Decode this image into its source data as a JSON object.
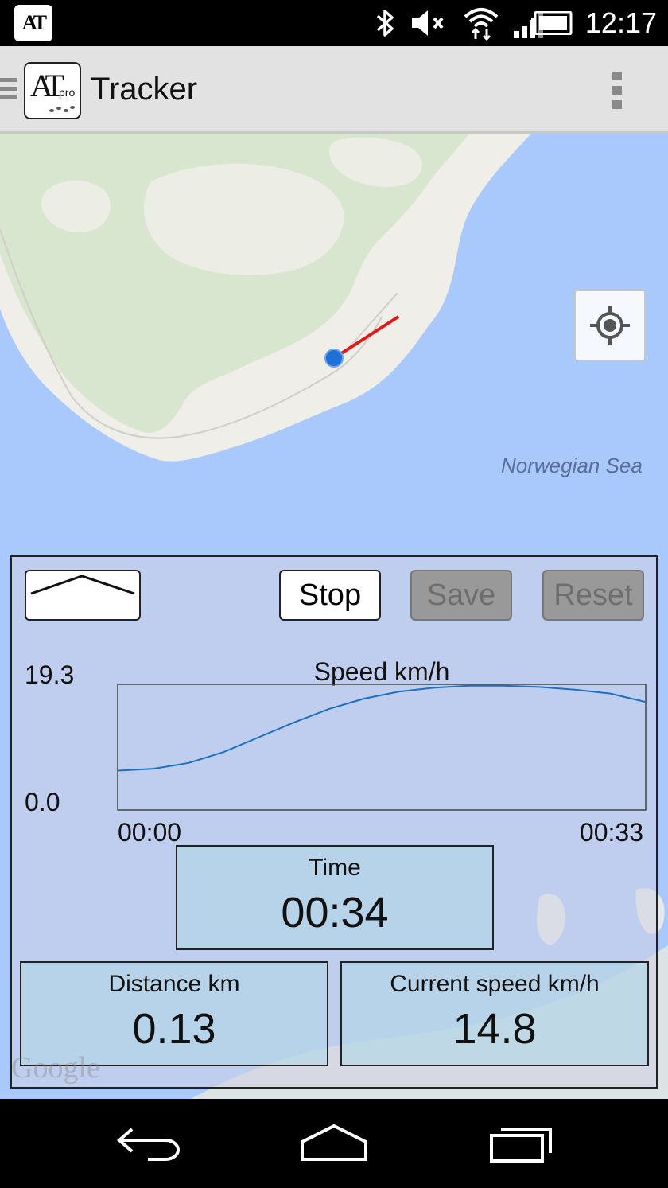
{
  "status_bar": {
    "app_icon_text": "AT",
    "time": "12:17",
    "icons": [
      "bluetooth-icon",
      "volume-muted-icon",
      "wifi-icon",
      "signal-icon",
      "battery-icon"
    ]
  },
  "action_bar": {
    "title": "Tracker",
    "logo_text": "AT",
    "logo_sub": "pro"
  },
  "map": {
    "sea_label": "Norwegian Sea",
    "attribution": "Google",
    "colors": {
      "water": "#a9c9fd",
      "land": "#efeee9",
      "forest": "#d9e6cf",
      "track": "#e01818",
      "position": "#1f6fd6"
    }
  },
  "panel": {
    "buttons": {
      "stop": "Stop",
      "save": "Save",
      "reset": "Reset"
    },
    "time": {
      "label": "Time",
      "value": "00:34"
    },
    "distance": {
      "label": "Distance km",
      "value": "0.13"
    },
    "current_speed": {
      "label": "Current speed km/h",
      "value": "14.8"
    }
  },
  "chart_data": {
    "type": "line",
    "title": "Speed km/h",
    "y_max_label": "19.3",
    "y_min_label": "0.0",
    "x_start_label": "00:00",
    "x_end_label": "00:33",
    "xlim": [
      0,
      33
    ],
    "ylim": [
      0,
      19.3
    ],
    "color": "#1c6fc4",
    "series": [
      {
        "x": [
          0,
          2.2,
          4.4,
          6.6,
          8.8,
          11,
          13.2,
          15.4,
          17.6,
          19.8,
          22,
          24.2,
          26.4,
          28.6,
          30.8,
          33
        ],
        "values": [
          6.0,
          6.3,
          7.2,
          8.9,
          11.2,
          13.5,
          15.6,
          17.2,
          18.3,
          18.9,
          19.2,
          19.2,
          19.0,
          18.6,
          18.0,
          16.7
        ]
      }
    ]
  },
  "nav_bar": {
    "icons": [
      "back-icon",
      "home-icon",
      "recents-icon"
    ]
  }
}
